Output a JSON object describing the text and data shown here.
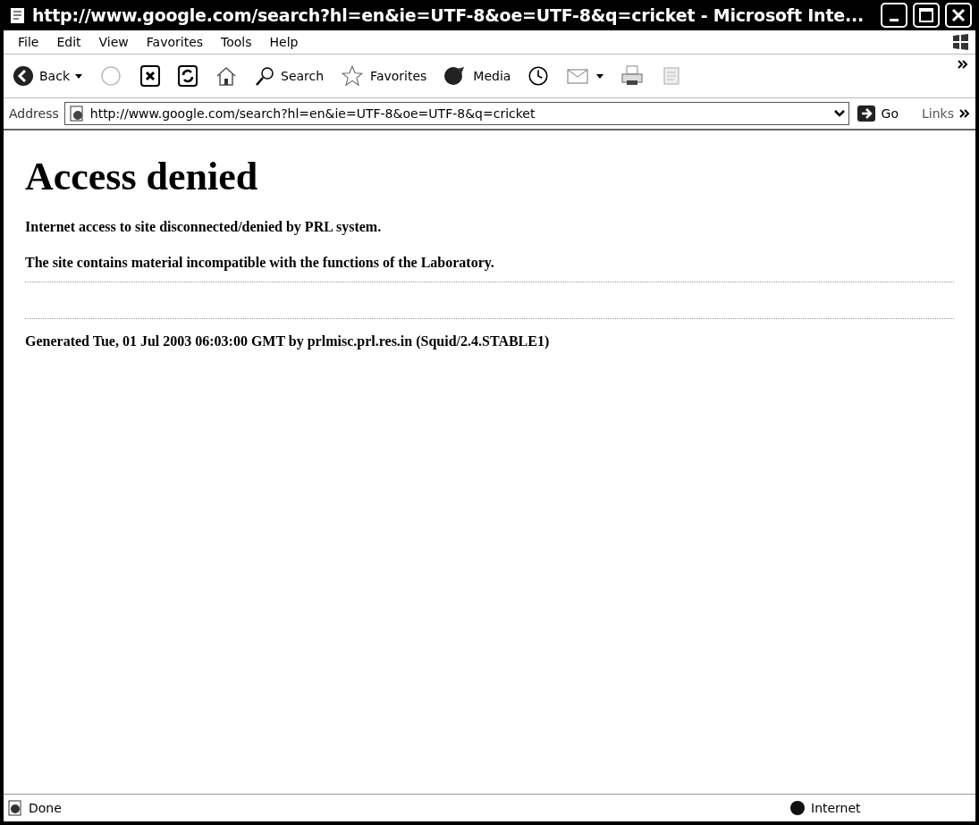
{
  "window": {
    "title": "http://www.google.com/search?hl=en&ie=UTF-8&oe=UTF-8&q=cricket - Microsoft Inte..."
  },
  "menu": [
    "File",
    "Edit",
    "View",
    "Favorites",
    "Tools",
    "Help"
  ],
  "toolbar": [
    {
      "label": "Back",
      "dropdown": true
    },
    {
      "dropdown": false
    },
    {
      "dropdown": false
    },
    {
      "dropdown": false
    },
    {
      "dropdown": false
    },
    {
      "label": "Search",
      "dropdown": false
    },
    {
      "label": "Favorites",
      "dropdown": false
    },
    {
      "label": "Media",
      "dropdown": false
    },
    {
      "dropdown": false
    },
    {
      "dropdown": true
    },
    {
      "dropdown": false
    },
    {
      "dropdown": false
    }
  ],
  "address": {
    "label": "Address",
    "value": "http://www.google.com/search?hl=en&ie=UTF-8&oe=UTF-8&q=cricket",
    "go": "Go",
    "links": "Links"
  },
  "content": {
    "heading": "Access denied",
    "paragraphs": [
      "Internet access to site disconnected/denied by PRL system.",
      "The site contains material incompatible with the functions of the Laboratory."
    ],
    "footer": "Generated Tue, 01 Jul 2003 06:03:00 GMT by prlmisc.prl.res.in (Squid/2.4.STABLE1)"
  },
  "status_bar": {
    "text": "Done",
    "zone": "Internet"
  }
}
